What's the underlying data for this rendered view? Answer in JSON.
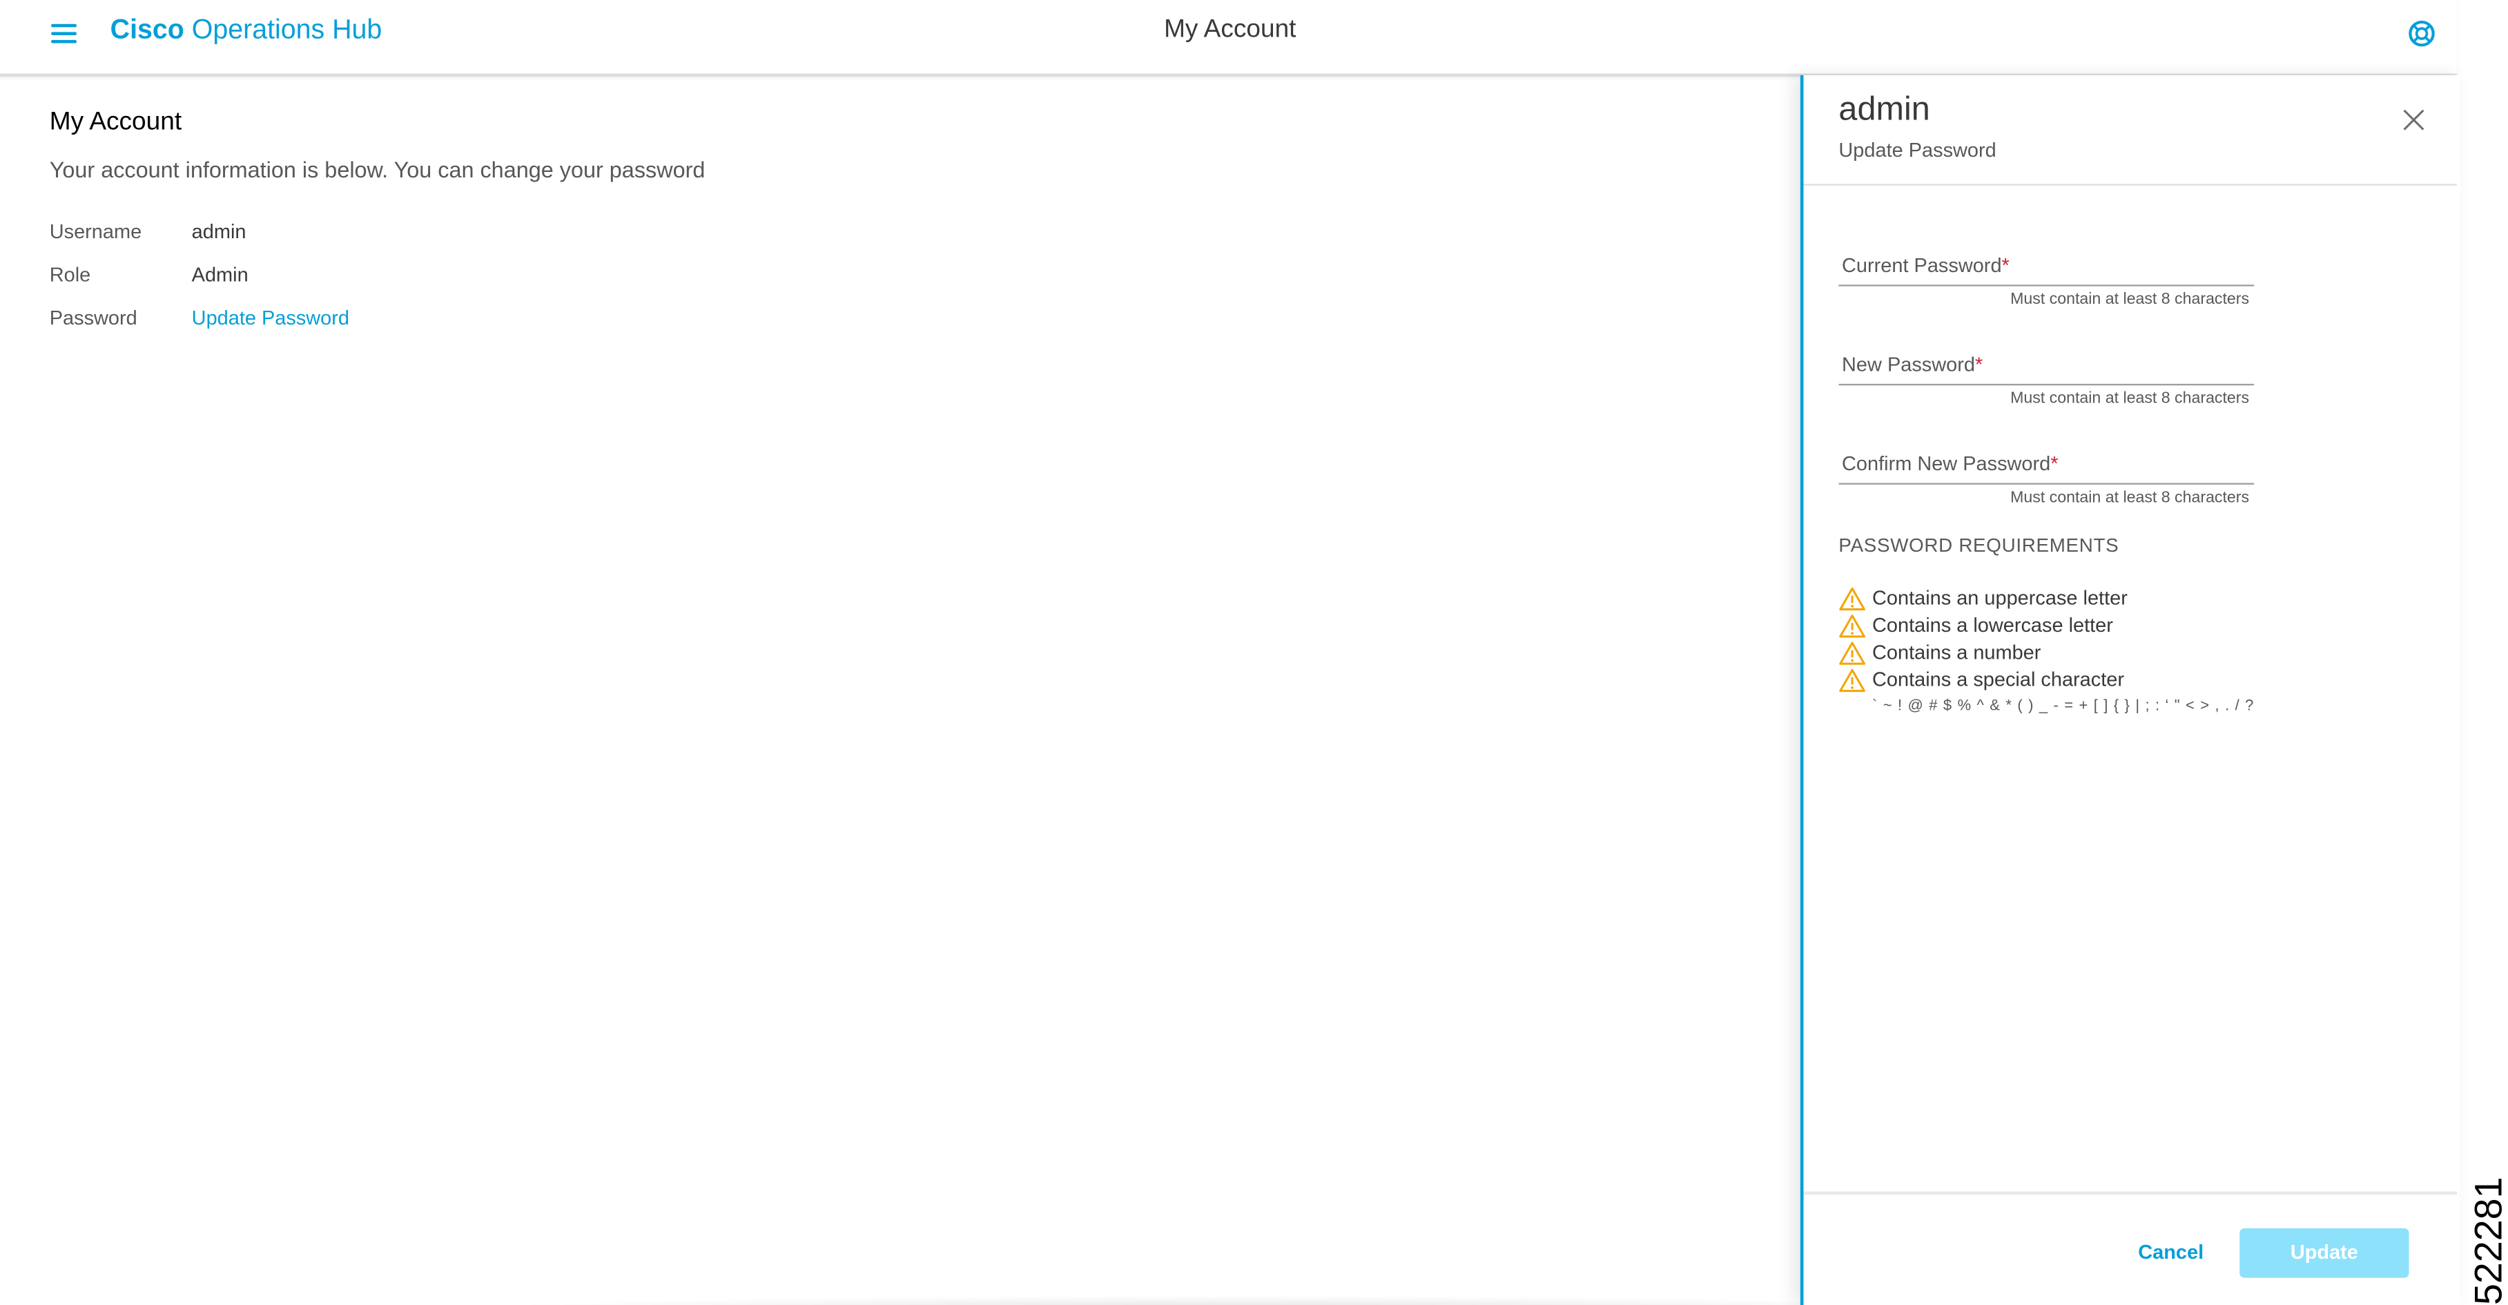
{
  "header": {
    "brand_bold": "Cisco",
    "brand_rest": "Operations Hub",
    "title": "My Account",
    "icons": {
      "menu": "hamburger-menu-icon",
      "help": "help-lifebuoy-icon"
    },
    "accent_color": "#049fd9"
  },
  "main": {
    "title": "My Account",
    "description": "Your account information is below. You can change your password",
    "rows": [
      {
        "label": "Username",
        "value": "admin"
      },
      {
        "label": "Role",
        "value": "Admin"
      },
      {
        "label": "Password",
        "value": "Update Password"
      }
    ]
  },
  "drawer": {
    "title": "admin",
    "subtitle": "Update Password",
    "close_icon": "close-icon",
    "fields": [
      {
        "label": "Current Password",
        "required_mark": "*",
        "value": "",
        "help": "Must contain at least 8 characters"
      },
      {
        "label": "New Password",
        "required_mark": "*",
        "value": "",
        "help": "Must contain at least 8 characters"
      },
      {
        "label": "Confirm New Password",
        "required_mark": "*",
        "value": "",
        "help": "Must contain at least 8 characters"
      }
    ],
    "requirements": {
      "heading": "PASSWORD REQUIREMENTS",
      "status_icon": "warning-triangle-icon",
      "warning_color": "#f2a500",
      "items": [
        "Contains an uppercase letter",
        "Contains a lowercase letter",
        "Contains a number",
        "Contains a special character"
      ],
      "special_chars": "` ~ ! @ # $ % ^ & * ( ) _ - = + [ ] { } | ; : ‘ \" < > , . / ?"
    },
    "buttons": {
      "cancel": "Cancel",
      "update": "Update"
    },
    "update_disabled_color": "#8ee1fa"
  },
  "figure_number": "522281"
}
